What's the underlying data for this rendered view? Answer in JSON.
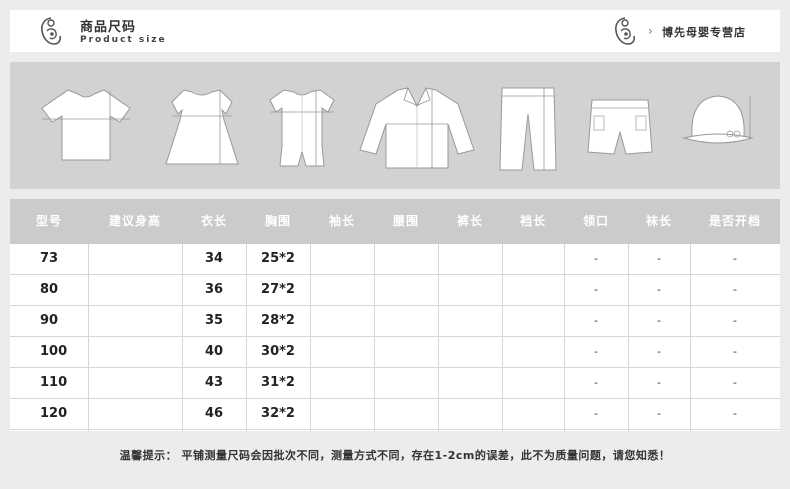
{
  "header": {
    "title_cn": "商品尺码",
    "title_en": "Product size",
    "store_name": "博先母婴专营店",
    "arrow_icon": "chevron-right-icon"
  },
  "garments": [
    "t-shirt",
    "dress",
    "romper",
    "jacket",
    "trousers",
    "shorts",
    "hat"
  ],
  "table": {
    "columns": [
      "型号",
      "建议身高",
      "衣长",
      "胸围",
      "袖长",
      "腰围",
      "裤长",
      "裆长",
      "领口",
      "袜长",
      "是否开档"
    ],
    "rows": [
      {
        "size": "73",
        "height": "",
        "length": "34",
        "chest": "25*2",
        "sleeve": "",
        "waist": "",
        "pants": "",
        "crotch": "",
        "collar": "-",
        "sock": "-",
        "open": "-"
      },
      {
        "size": "80",
        "height": "",
        "length": "36",
        "chest": "27*2",
        "sleeve": "",
        "waist": "",
        "pants": "",
        "crotch": "",
        "collar": "-",
        "sock": "-",
        "open": "-"
      },
      {
        "size": "90",
        "height": "",
        "length": "35",
        "chest": "28*2",
        "sleeve": "",
        "waist": "",
        "pants": "",
        "crotch": "",
        "collar": "-",
        "sock": "-",
        "open": "-"
      },
      {
        "size": "100",
        "height": "",
        "length": "40",
        "chest": "30*2",
        "sleeve": "",
        "waist": "",
        "pants": "",
        "crotch": "",
        "collar": "-",
        "sock": "-",
        "open": "-"
      },
      {
        "size": "110",
        "height": "",
        "length": "43",
        "chest": "31*2",
        "sleeve": "",
        "waist": "",
        "pants": "",
        "crotch": "",
        "collar": "-",
        "sock": "-",
        "open": "-"
      },
      {
        "size": "120",
        "height": "",
        "length": "46",
        "chest": "32*2",
        "sleeve": "",
        "waist": "",
        "pants": "",
        "crotch": "",
        "collar": "-",
        "sock": "-",
        "open": "-"
      }
    ]
  },
  "footer": {
    "note": "温馨提示： 平铺测量尺码会因批次不同，测量方式不同，存在1-2cm的误差，此不为质量问题，请您知悉！"
  },
  "colors": {
    "header_bg": "#ffffff",
    "band_bg": "#d2d2d2",
    "table_head_bg": "#cbcbcb",
    "page_bg": "#ececec"
  }
}
